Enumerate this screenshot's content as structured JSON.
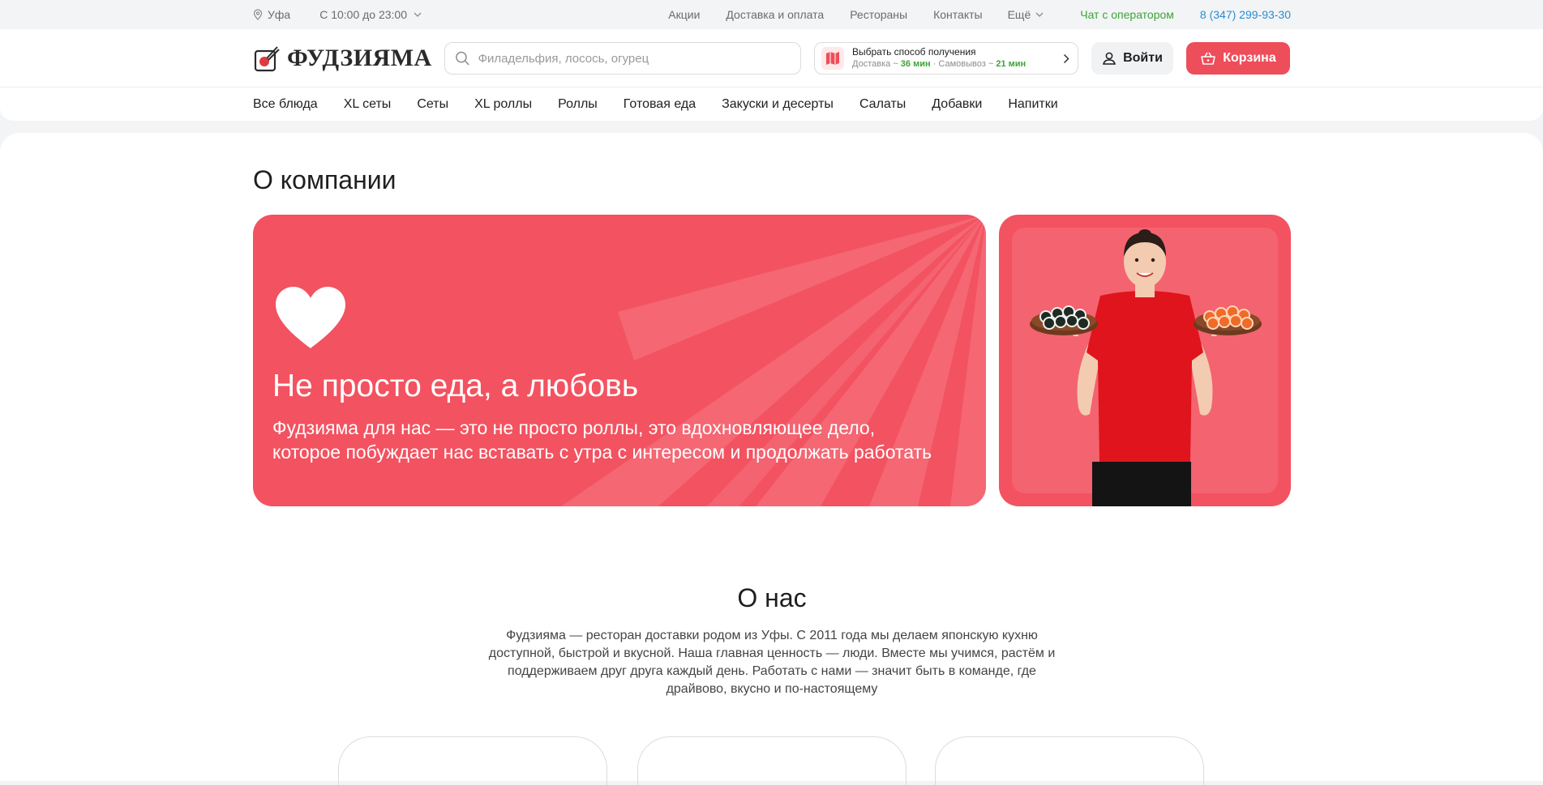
{
  "topbar": {
    "city": "Уфа",
    "hours": "С 10:00 до 23:00",
    "links": [
      "Акции",
      "Доставка и оплата",
      "Рестораны",
      "Контакты"
    ],
    "more": "Ещё",
    "chat": "Чат с оператором",
    "phone": "8 (347) 299-93-30"
  },
  "header": {
    "logo_text": "ФУДЗИЯМА",
    "search_placeholder": "Филадельфия, лосось, огурец",
    "delivery_title": "Выбрать способ получения",
    "delivery_label": "Доставка ~",
    "delivery_time": "36 мин",
    "pickup_label": "· Самовывоз ~",
    "pickup_time": "21 мин",
    "login": "Войти",
    "cart": "Корзина"
  },
  "categories": [
    "Все блюда",
    "XL сеты",
    "Сеты",
    "XL роллы",
    "Роллы",
    "Готовая еда",
    "Закуски и десерты",
    "Салаты",
    "Добавки",
    "Напитки"
  ],
  "page": {
    "title": "О компании",
    "hero_title": "Не просто еда, а любовь",
    "hero_text": "Фудзияма для нас — это не просто роллы, это вдохновляющее дело, которое побуждает нас вставать с утра с интересом и продолжать работать",
    "about_title": "О нас",
    "about_text": "Фудзияма — ресторан доставки родом из Уфы. С 2011 года мы делаем японскую кухню доступной, быстрой и вкусной. Наша главная ценность — люди. Вместе мы учимся, растём и поддерживаем друг друга каждый день. Работать с нами — значит быть в команде, где драйвово, вкусно и по-настоящему"
  },
  "colors": {
    "accent": "#ee4d5a",
    "hero": "#f35260",
    "green": "#3aa535",
    "phone": "#2a8ccf"
  }
}
